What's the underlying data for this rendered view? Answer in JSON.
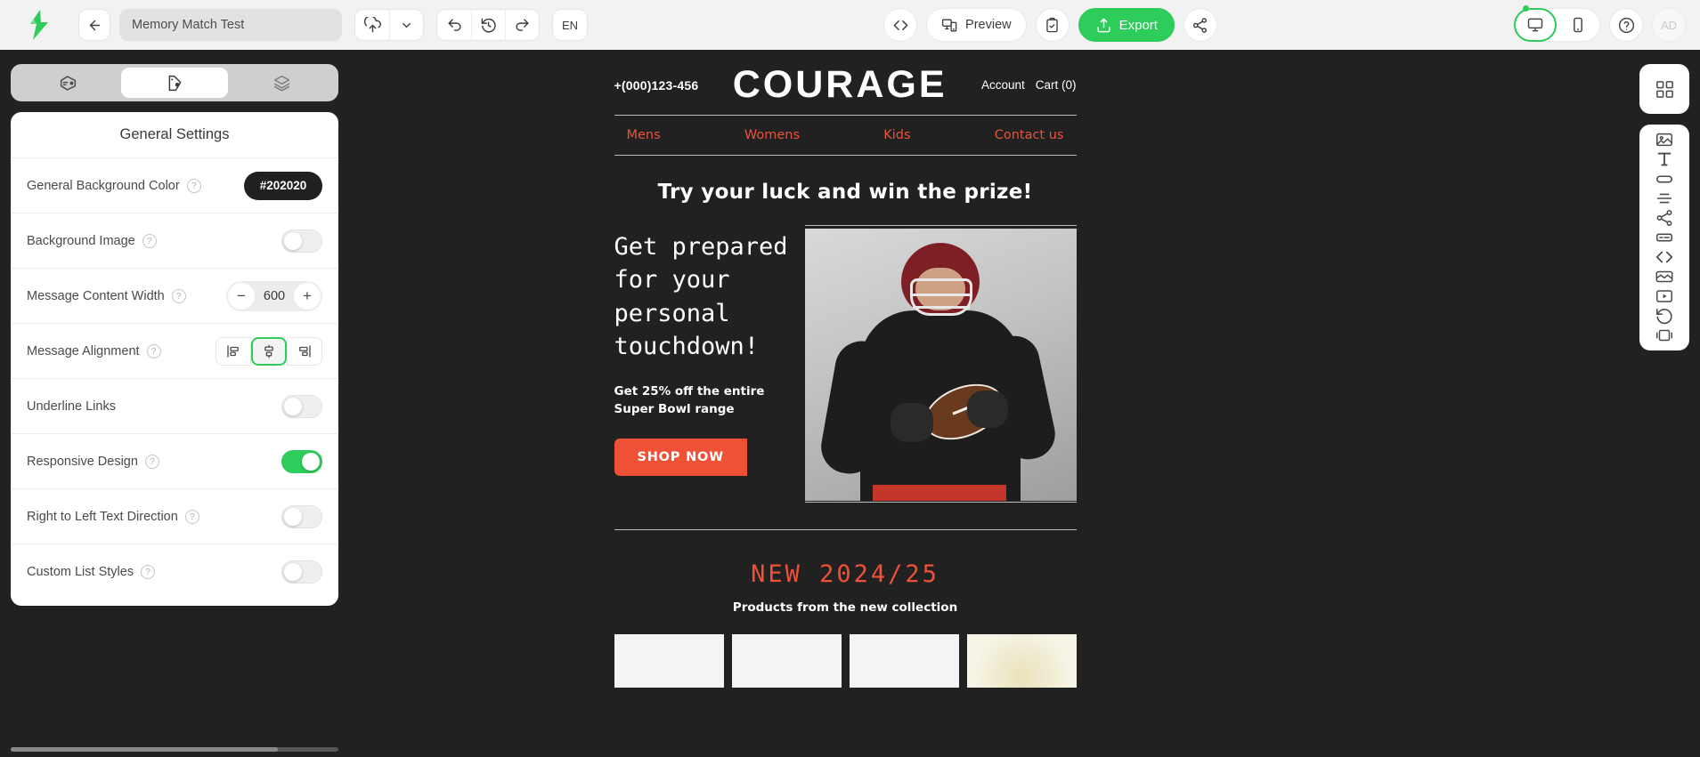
{
  "app": {
    "logo": "stripo-logo-icon"
  },
  "toolbar": {
    "back_label": "back-arrow-icon",
    "title_value": "Memory Match Test",
    "title_placeholder": "Untitled message",
    "upload_label": "cloud-upload-icon",
    "chevron_label": "chevron-down-icon",
    "undo_label": "undo-icon",
    "history_label": "history-icon",
    "redo_label": "redo-icon",
    "language": "EN",
    "code_label": "code-icon",
    "preview_label": "Preview",
    "checklist_label": "clipboard-check-icon",
    "export_label": "Export",
    "share_label": "share-icon",
    "desktop_label": "desktop-icon",
    "mobile_label": "mobile-icon",
    "help_label": "help-circle-icon",
    "avatar_initials": "AD",
    "active_device": "desktop"
  },
  "left_panel": {
    "tabs": [
      {
        "name": "content-tab",
        "icon": "message-tag-icon",
        "active": false
      },
      {
        "name": "appearance-tab",
        "icon": "palette-icon",
        "active": true
      },
      {
        "name": "layers-tab",
        "icon": "layers-icon",
        "active": false
      }
    ],
    "title": "General Settings",
    "rows": [
      {
        "label": "General Background Color",
        "help": true,
        "control": "color",
        "value": "#202020"
      },
      {
        "label": "Background Image",
        "help": true,
        "control": "switch",
        "value": "off"
      },
      {
        "label": "Message Content Width",
        "help": true,
        "control": "stepper",
        "value": "600",
        "minus": "−",
        "plus": "+"
      },
      {
        "label": "Message Alignment",
        "help": true,
        "control": "segment",
        "value": "center",
        "options": [
          "align-left-icon",
          "align-center-icon",
          "align-right-icon"
        ]
      },
      {
        "label": "Underline Links",
        "help": false,
        "control": "switch",
        "value": "off"
      },
      {
        "label": "Responsive Design",
        "help": true,
        "control": "switch",
        "value": "on"
      },
      {
        "label": "Right to Left Text Direction",
        "help": true,
        "control": "switch",
        "value": "off"
      },
      {
        "label": "Custom List Styles",
        "help": true,
        "control": "switch",
        "value": "off"
      }
    ]
  },
  "email": {
    "background_color": "#212121",
    "accent_color": "#ef5136",
    "phone": "+(000)123-456",
    "brand": "COURAGE",
    "header_links": [
      "Account",
      "Cart (0)"
    ],
    "nav": [
      "Mens",
      "Womens",
      "Kids",
      "Contact us"
    ],
    "hero_title": "Try your luck and win the prize!",
    "hero_heading": "Get prepared for your personal touchdown!",
    "hero_sub": "Get 25% off the entire Super Bowl range",
    "cta_label": "SHOP NOW",
    "hero_image_alt": "american-football-player-photo",
    "new_title": "NEW 2024/25",
    "new_sub": "Products from the new collection",
    "products": [
      "product-card-1",
      "product-card-2",
      "product-card-3",
      "product-card-4"
    ]
  },
  "right_rail": {
    "top_icon": "structure-blocks-icon",
    "items": [
      "image-block-icon",
      "text-block-icon",
      "button-block-icon",
      "divider-block-icon",
      "social-block-icon",
      "menu-block-icon",
      "html-block-icon",
      "banner-block-icon",
      "video-block-icon",
      "timer-block-icon",
      "carousel-block-icon"
    ]
  }
}
